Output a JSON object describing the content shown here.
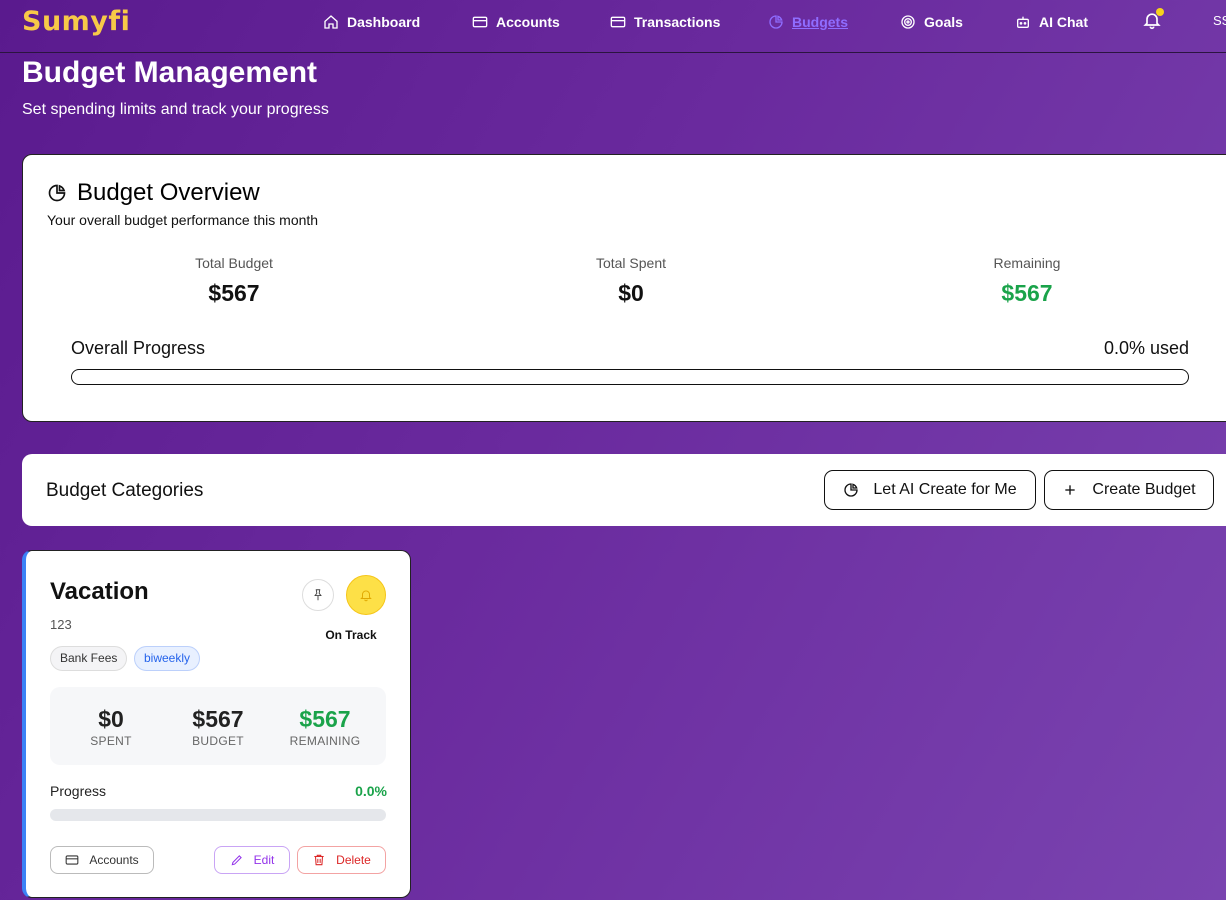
{
  "app": {
    "logo": "Sumyfi",
    "user_initials": "SS"
  },
  "nav": {
    "items": [
      {
        "label": "Dashboard",
        "icon": "home-icon"
      },
      {
        "label": "Accounts",
        "icon": "card-icon"
      },
      {
        "label": "Transactions",
        "icon": "card-icon"
      },
      {
        "label": "Budgets",
        "icon": "pie-chart-icon",
        "active": true
      },
      {
        "label": "Goals",
        "icon": "target-icon"
      },
      {
        "label": "AI Chat",
        "icon": "bot-icon"
      }
    ],
    "notifications_badge": true
  },
  "header": {
    "title": "Budget Management",
    "subtitle": "Set spending limits and track your progress"
  },
  "overview": {
    "title": "Budget Overview",
    "subtitle": "Your overall budget performance this month",
    "total_budget_label": "Total Budget",
    "total_budget_value": "$567",
    "total_spent_label": "Total Spent",
    "total_spent_value": "$0",
    "remaining_label": "Remaining",
    "remaining_value": "$567",
    "progress_label": "Overall Progress",
    "progress_used": "0.0% used",
    "progress_fraction": 0.0
  },
  "categories": {
    "title": "Budget Categories",
    "ai_button": "Let AI Create for Me",
    "create_button": "Create Budget"
  },
  "budget_card": {
    "name": "Vacation",
    "description": "123",
    "status": "On Track",
    "tags": [
      "Bank Fees",
      "biweekly"
    ],
    "spent_value": "$0",
    "spent_label": "SPENT",
    "budget_value": "$567",
    "budget_label": "BUDGET",
    "remaining_value": "$567",
    "remaining_label": "REMAINING",
    "progress_label": "Progress",
    "progress_pct": "0.0%",
    "progress_fraction": 0.0,
    "accounts_button": "Accounts",
    "edit_button": "Edit",
    "delete_button": "Delete"
  },
  "colors": {
    "accent": "#7c3aed",
    "logo": "#f7c948",
    "positive": "#1aa34a",
    "danger": "#dc2626",
    "card_border_left": "#3b82f6"
  }
}
